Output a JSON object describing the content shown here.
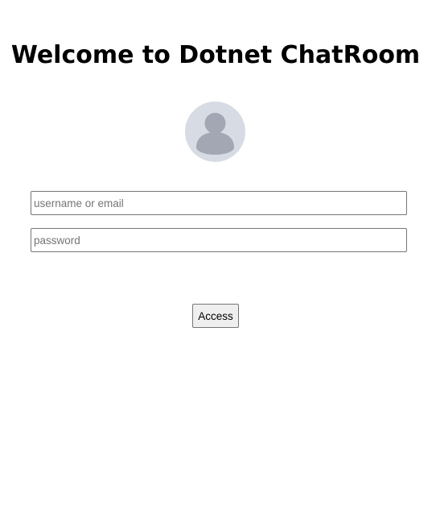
{
  "page": {
    "title": "Welcome to Dotnet ChatRoom"
  },
  "avatar": {
    "icon": "user-avatar-icon",
    "background_color": "#d7dbe3",
    "figure_color": "#a3a6b3"
  },
  "login_form": {
    "username": {
      "placeholder": "username or email",
      "value": ""
    },
    "password": {
      "placeholder": "password",
      "value": ""
    },
    "submit_label": "Access"
  }
}
